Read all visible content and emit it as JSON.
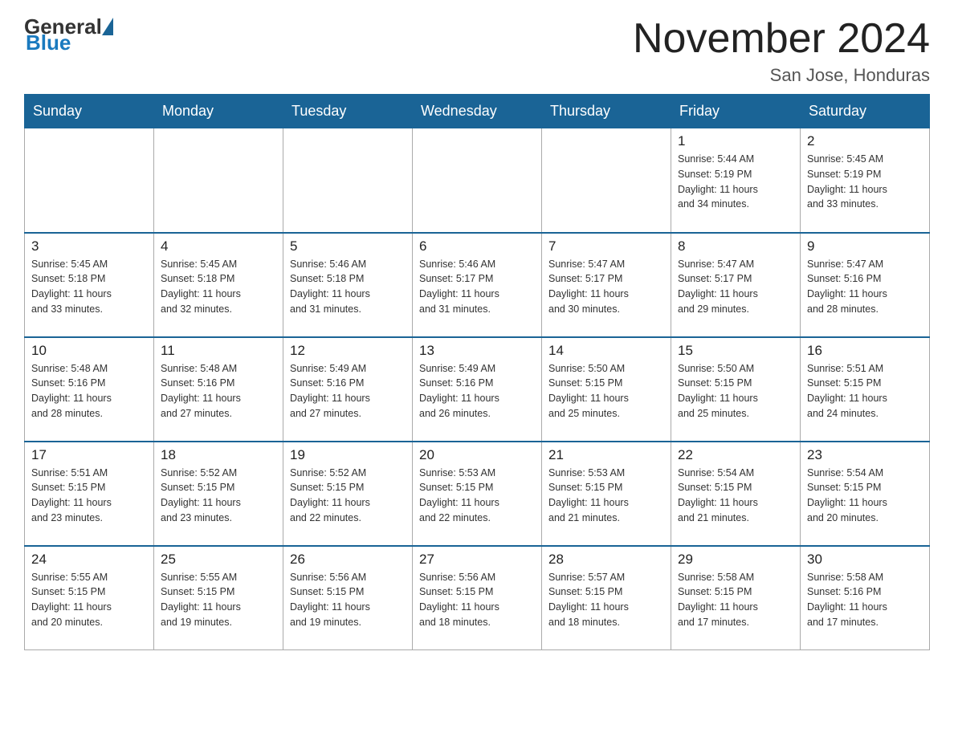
{
  "header": {
    "logo_general": "General",
    "logo_blue": "Blue",
    "month_title": "November 2024",
    "location": "San Jose, Honduras"
  },
  "weekdays": [
    "Sunday",
    "Monday",
    "Tuesday",
    "Wednesday",
    "Thursday",
    "Friday",
    "Saturday"
  ],
  "weeks": [
    [
      {
        "day": "",
        "info": ""
      },
      {
        "day": "",
        "info": ""
      },
      {
        "day": "",
        "info": ""
      },
      {
        "day": "",
        "info": ""
      },
      {
        "day": "",
        "info": ""
      },
      {
        "day": "1",
        "info": "Sunrise: 5:44 AM\nSunset: 5:19 PM\nDaylight: 11 hours\nand 34 minutes."
      },
      {
        "day": "2",
        "info": "Sunrise: 5:45 AM\nSunset: 5:19 PM\nDaylight: 11 hours\nand 33 minutes."
      }
    ],
    [
      {
        "day": "3",
        "info": "Sunrise: 5:45 AM\nSunset: 5:18 PM\nDaylight: 11 hours\nand 33 minutes."
      },
      {
        "day": "4",
        "info": "Sunrise: 5:45 AM\nSunset: 5:18 PM\nDaylight: 11 hours\nand 32 minutes."
      },
      {
        "day": "5",
        "info": "Sunrise: 5:46 AM\nSunset: 5:18 PM\nDaylight: 11 hours\nand 31 minutes."
      },
      {
        "day": "6",
        "info": "Sunrise: 5:46 AM\nSunset: 5:17 PM\nDaylight: 11 hours\nand 31 minutes."
      },
      {
        "day": "7",
        "info": "Sunrise: 5:47 AM\nSunset: 5:17 PM\nDaylight: 11 hours\nand 30 minutes."
      },
      {
        "day": "8",
        "info": "Sunrise: 5:47 AM\nSunset: 5:17 PM\nDaylight: 11 hours\nand 29 minutes."
      },
      {
        "day": "9",
        "info": "Sunrise: 5:47 AM\nSunset: 5:16 PM\nDaylight: 11 hours\nand 28 minutes."
      }
    ],
    [
      {
        "day": "10",
        "info": "Sunrise: 5:48 AM\nSunset: 5:16 PM\nDaylight: 11 hours\nand 28 minutes."
      },
      {
        "day": "11",
        "info": "Sunrise: 5:48 AM\nSunset: 5:16 PM\nDaylight: 11 hours\nand 27 minutes."
      },
      {
        "day": "12",
        "info": "Sunrise: 5:49 AM\nSunset: 5:16 PM\nDaylight: 11 hours\nand 27 minutes."
      },
      {
        "day": "13",
        "info": "Sunrise: 5:49 AM\nSunset: 5:16 PM\nDaylight: 11 hours\nand 26 minutes."
      },
      {
        "day": "14",
        "info": "Sunrise: 5:50 AM\nSunset: 5:15 PM\nDaylight: 11 hours\nand 25 minutes."
      },
      {
        "day": "15",
        "info": "Sunrise: 5:50 AM\nSunset: 5:15 PM\nDaylight: 11 hours\nand 25 minutes."
      },
      {
        "day": "16",
        "info": "Sunrise: 5:51 AM\nSunset: 5:15 PM\nDaylight: 11 hours\nand 24 minutes."
      }
    ],
    [
      {
        "day": "17",
        "info": "Sunrise: 5:51 AM\nSunset: 5:15 PM\nDaylight: 11 hours\nand 23 minutes."
      },
      {
        "day": "18",
        "info": "Sunrise: 5:52 AM\nSunset: 5:15 PM\nDaylight: 11 hours\nand 23 minutes."
      },
      {
        "day": "19",
        "info": "Sunrise: 5:52 AM\nSunset: 5:15 PM\nDaylight: 11 hours\nand 22 minutes."
      },
      {
        "day": "20",
        "info": "Sunrise: 5:53 AM\nSunset: 5:15 PM\nDaylight: 11 hours\nand 22 minutes."
      },
      {
        "day": "21",
        "info": "Sunrise: 5:53 AM\nSunset: 5:15 PM\nDaylight: 11 hours\nand 21 minutes."
      },
      {
        "day": "22",
        "info": "Sunrise: 5:54 AM\nSunset: 5:15 PM\nDaylight: 11 hours\nand 21 minutes."
      },
      {
        "day": "23",
        "info": "Sunrise: 5:54 AM\nSunset: 5:15 PM\nDaylight: 11 hours\nand 20 minutes."
      }
    ],
    [
      {
        "day": "24",
        "info": "Sunrise: 5:55 AM\nSunset: 5:15 PM\nDaylight: 11 hours\nand 20 minutes."
      },
      {
        "day": "25",
        "info": "Sunrise: 5:55 AM\nSunset: 5:15 PM\nDaylight: 11 hours\nand 19 minutes."
      },
      {
        "day": "26",
        "info": "Sunrise: 5:56 AM\nSunset: 5:15 PM\nDaylight: 11 hours\nand 19 minutes."
      },
      {
        "day": "27",
        "info": "Sunrise: 5:56 AM\nSunset: 5:15 PM\nDaylight: 11 hours\nand 18 minutes."
      },
      {
        "day": "28",
        "info": "Sunrise: 5:57 AM\nSunset: 5:15 PM\nDaylight: 11 hours\nand 18 minutes."
      },
      {
        "day": "29",
        "info": "Sunrise: 5:58 AM\nSunset: 5:15 PM\nDaylight: 11 hours\nand 17 minutes."
      },
      {
        "day": "30",
        "info": "Sunrise: 5:58 AM\nSunset: 5:16 PM\nDaylight: 11 hours\nand 17 minutes."
      }
    ]
  ]
}
